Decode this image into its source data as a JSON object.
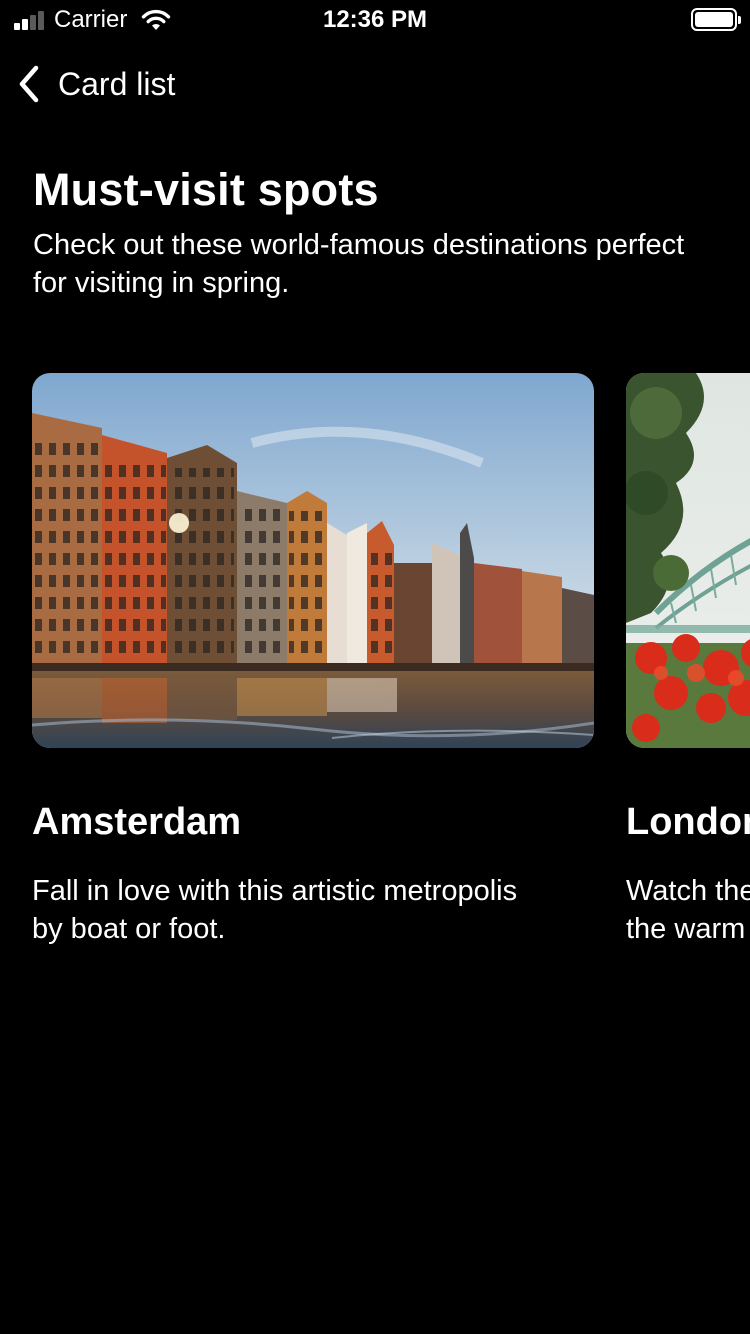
{
  "status_bar": {
    "carrier": "Carrier",
    "time": "12:36 PM",
    "signal_icon": "cellular-signal-icon",
    "wifi_icon": "wifi-icon",
    "battery_icon": "battery-full-icon"
  },
  "nav": {
    "back_icon": "chevron-left-icon",
    "back_label": "Card list"
  },
  "header": {
    "title": "Must-visit spots",
    "subtitle": "Check out these world-famous destinations perfect for visiting in spring."
  },
  "cards": [
    {
      "title": "Amsterdam",
      "description": "Fall in love with this artistic metropolis\nby boat or foot.",
      "image": "amsterdam-canal-houses-photo"
    },
    {
      "title": "London",
      "description": "Watch the\nthe warm",
      "image": "london-bridge-with-red-flowers-photo"
    }
  ],
  "colors": {
    "background": "#000000",
    "text": "#ffffff"
  }
}
